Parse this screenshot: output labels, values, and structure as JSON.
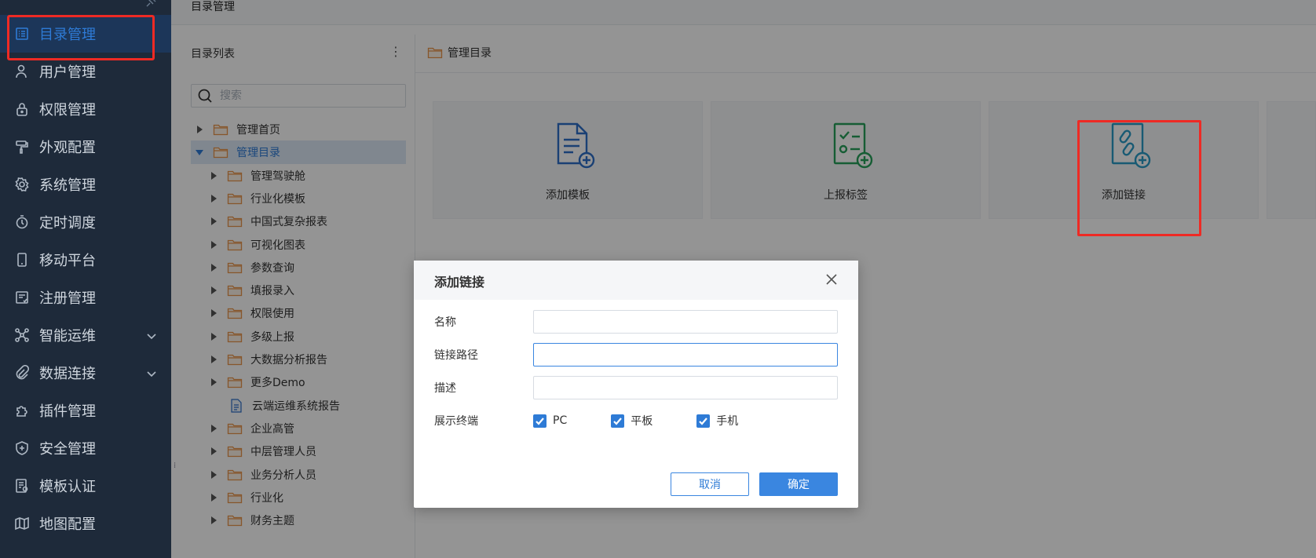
{
  "sidebar": {
    "items": [
      {
        "label": "目录管理",
        "icon": "list-icon",
        "active": true
      },
      {
        "label": "用户管理",
        "icon": "user-icon"
      },
      {
        "label": "权限管理",
        "icon": "lock-icon"
      },
      {
        "label": "外观配置",
        "icon": "paint-roller-icon"
      },
      {
        "label": "系统管理",
        "icon": "gear-icon"
      },
      {
        "label": "定时调度",
        "icon": "timer-icon"
      },
      {
        "label": "移动平台",
        "icon": "mobile-icon"
      },
      {
        "label": "注册管理",
        "icon": "register-icon"
      },
      {
        "label": "智能运维",
        "icon": "network-icon",
        "expandable": true
      },
      {
        "label": "数据连接",
        "icon": "paperclip-icon",
        "expandable": true
      },
      {
        "label": "插件管理",
        "icon": "puzzle-icon"
      },
      {
        "label": "安全管理",
        "icon": "shield-icon"
      },
      {
        "label": "模板认证",
        "icon": "certificate-icon"
      },
      {
        "label": "地图配置",
        "icon": "map-icon"
      }
    ]
  },
  "topbar": {
    "title": "目录管理"
  },
  "tree": {
    "header": "目录列表",
    "search_placeholder": "搜索",
    "items": [
      {
        "label": "管理首页",
        "level": 0,
        "type": "folder",
        "expanded": false
      },
      {
        "label": "管理目录",
        "level": 0,
        "type": "folder",
        "expanded": true,
        "selected": true
      },
      {
        "label": "管理驾驶舱",
        "level": 1,
        "type": "folder"
      },
      {
        "label": "行业化模板",
        "level": 1,
        "type": "folder"
      },
      {
        "label": "中国式复杂报表",
        "level": 1,
        "type": "folder"
      },
      {
        "label": "可视化图表",
        "level": 1,
        "type": "folder"
      },
      {
        "label": "参数查询",
        "level": 1,
        "type": "folder"
      },
      {
        "label": "填报录入",
        "level": 1,
        "type": "folder"
      },
      {
        "label": "权限使用",
        "level": 1,
        "type": "folder"
      },
      {
        "label": "多级上报",
        "level": 1,
        "type": "folder"
      },
      {
        "label": "大数据分析报告",
        "level": 1,
        "type": "folder"
      },
      {
        "label": "更多Demo",
        "level": 1,
        "type": "folder"
      },
      {
        "label": "云端运维系统报告",
        "level": 1,
        "type": "file"
      },
      {
        "label": "企业高管",
        "level": 1,
        "type": "folder"
      },
      {
        "label": "中层管理人员",
        "level": 1,
        "type": "folder"
      },
      {
        "label": "业务分析人员",
        "level": 1,
        "type": "folder"
      },
      {
        "label": "行业化",
        "level": 1,
        "type": "folder"
      },
      {
        "label": "财务主题",
        "level": 1,
        "type": "folder"
      }
    ]
  },
  "content": {
    "breadcrumb": "管理目录",
    "cards": [
      {
        "label": "添加模板",
        "icon": "add-template-icon",
        "color": "#2e6fc9"
      },
      {
        "label": "上报标签",
        "icon": "report-tag-icon",
        "color": "#27a05a"
      },
      {
        "label": "添加链接",
        "icon": "add-link-icon",
        "color": "#2a9bc7"
      }
    ]
  },
  "dialog": {
    "title": "添加链接",
    "fields": [
      {
        "label": "名称",
        "value": ""
      },
      {
        "label": "链接路径",
        "value": ""
      },
      {
        "label": "描述",
        "value": ""
      }
    ],
    "terminal_label": "展示终端",
    "terminals": [
      {
        "label": "PC",
        "checked": true
      },
      {
        "label": "平板",
        "checked": true
      },
      {
        "label": "手机",
        "checked": true
      }
    ],
    "cancel_label": "取消",
    "ok_label": "确定"
  },
  "colors": {
    "accent": "#2e7bd6",
    "highlight": "#ee2a24",
    "sidebar_bg": "#1e2a3a"
  }
}
